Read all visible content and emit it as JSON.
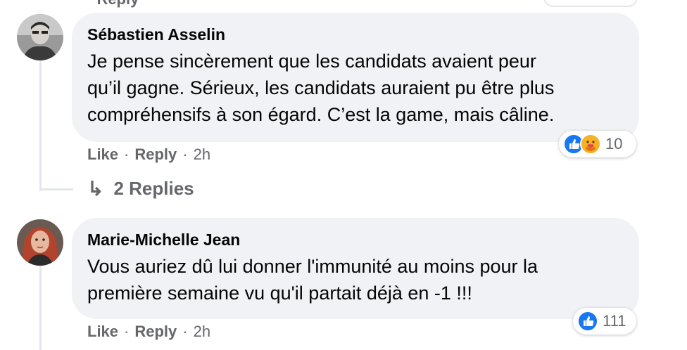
{
  "top": {
    "fragment": "· Reply"
  },
  "comments": [
    {
      "author": "Sébastien Asselin",
      "text": "Je pense sincèrement que les candidats avaient peur\nqu’il gagne. Sérieux, les candidats auraient pu être plus\ncompréhensifs à son égard. C’est la game, mais câline.",
      "like_label": "Like",
      "reply_label": "Reply",
      "time": "2h",
      "reaction_count": "10",
      "reactions": [
        "like-icon",
        "care-icon"
      ]
    },
    {
      "author": "Marie-Michelle Jean",
      "text": "Vous auriez dû lui donner l'immunité au moins pour la\npremière semaine vu qu'il partait déjà en -1 !!!",
      "like_label": "Like",
      "reply_label": "Reply",
      "time": "2h",
      "reaction_count": "111",
      "reactions": [
        "like-icon"
      ]
    }
  ],
  "replies_link": {
    "arrow": "↳",
    "label": "2 Replies"
  },
  "colors": {
    "like_blue": "#1877f2",
    "bubble": "#f0f2f5",
    "meta": "#65676b"
  }
}
